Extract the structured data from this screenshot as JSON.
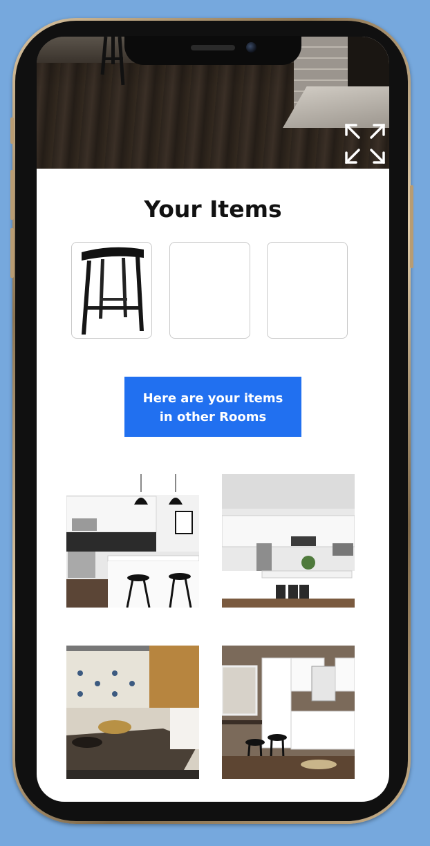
{
  "screen": {
    "icons": {
      "expand": "expand-arrows-icon"
    },
    "items_title": "Your Items",
    "item_slots": [
      {
        "filled": true,
        "content": "bar-stool-image"
      },
      {
        "filled": false
      },
      {
        "filled": false
      }
    ],
    "cta_label": "Here are your items\nin other Rooms",
    "rooms": [
      {
        "name": "kitchen-room-1"
      },
      {
        "name": "kitchen-room-2"
      },
      {
        "name": "kitchen-room-3"
      },
      {
        "name": "kitchen-room-4"
      }
    ]
  },
  "colors": {
    "background": "#76a8dd",
    "accent": "#2170f0",
    "screen": "#ffffff"
  }
}
